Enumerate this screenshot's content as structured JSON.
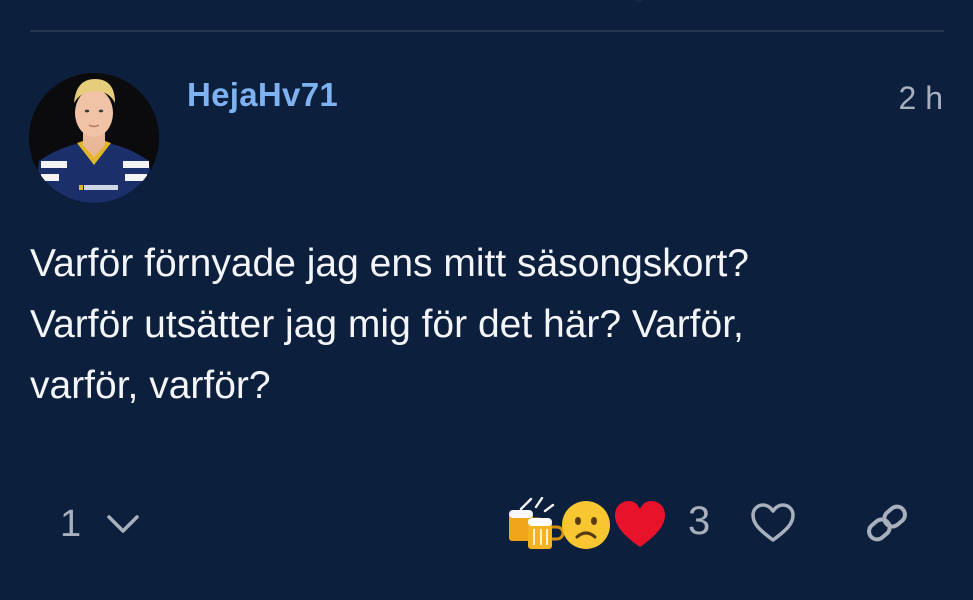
{
  "post": {
    "username": "HejaHv71",
    "timestamp": "2 h",
    "text": "Varför förnyade jag ens mitt säsongskort?\nVarför utsätter jag mig för det här? Varför,\nvarför, varför?"
  },
  "footer": {
    "reply_count": "1",
    "reaction_count": "3",
    "reactions": [
      "beer-mugs-emoji",
      "frowning-face-emoji",
      "red-heart-emoji"
    ],
    "icons": {
      "chevron": "chevron-down-icon",
      "heart": "heart-outline-icon",
      "link": "link-icon"
    }
  },
  "colors": {
    "background": "#0c1f3d",
    "username": "#7fb2f0",
    "text": "#f3f5f8",
    "muted": "#a8b0bd",
    "heart": "#e8132b"
  }
}
